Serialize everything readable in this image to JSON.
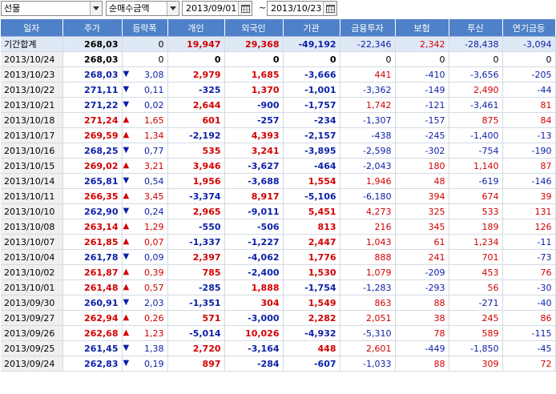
{
  "toolbar": {
    "market": "선물",
    "metric": "순매수금액",
    "date_from": "2013/09/01",
    "date_sep": "~",
    "date_to": "2013/10/23"
  },
  "columns": [
    "일자",
    "주가",
    "등락폭",
    "개인",
    "외국인",
    "기관",
    "금융투자",
    "보험",
    "투신",
    "연기금등"
  ],
  "summary": {
    "label": "기간합계",
    "price": "268,03",
    "change": "0",
    "individual": "19,947",
    "foreign": "29,368",
    "institution": "-49,192",
    "fin_invest": "-22,346",
    "insurance": "2,342",
    "trust": "-28,438",
    "pension": "-3,094"
  },
  "rows": [
    {
      "date": "2013/10/24",
      "price": "268,03",
      "dir": "",
      "change": "0",
      "individual": "0",
      "foreign": "0",
      "institution": "0",
      "fin_invest": "0",
      "insurance": "0",
      "trust": "0",
      "pension": "0"
    },
    {
      "date": "2013/10/23",
      "price": "268,03",
      "dir": "down",
      "change": "3,08",
      "individual": "2,979",
      "foreign": "1,685",
      "institution": "-3,666",
      "fin_invest": "441",
      "insurance": "-410",
      "trust": "-3,656",
      "pension": "-205"
    },
    {
      "date": "2013/10/22",
      "price": "271,11",
      "dir": "down",
      "change": "0,11",
      "individual": "-325",
      "foreign": "1,370",
      "institution": "-1,001",
      "fin_invest": "-3,362",
      "insurance": "-149",
      "trust": "2,490",
      "pension": "-44"
    },
    {
      "date": "2013/10/21",
      "price": "271,22",
      "dir": "down",
      "change": "0,02",
      "individual": "2,644",
      "foreign": "-900",
      "institution": "-1,757",
      "fin_invest": "1,742",
      "insurance": "-121",
      "trust": "-3,461",
      "pension": "81"
    },
    {
      "date": "2013/10/18",
      "price": "271,24",
      "dir": "up",
      "change": "1,65",
      "individual": "601",
      "foreign": "-257",
      "institution": "-234",
      "fin_invest": "-1,307",
      "insurance": "-157",
      "trust": "875",
      "pension": "84"
    },
    {
      "date": "2013/10/17",
      "price": "269,59",
      "dir": "up",
      "change": "1,34",
      "individual": "-2,192",
      "foreign": "4,393",
      "institution": "-2,157",
      "fin_invest": "-438",
      "insurance": "-245",
      "trust": "-1,400",
      "pension": "-13"
    },
    {
      "date": "2013/10/16",
      "price": "268,25",
      "dir": "down",
      "change": "0,77",
      "individual": "535",
      "foreign": "3,241",
      "institution": "-3,895",
      "fin_invest": "-2,598",
      "insurance": "-302",
      "trust": "-754",
      "pension": "-190"
    },
    {
      "date": "2013/10/15",
      "price": "269,02",
      "dir": "up",
      "change": "3,21",
      "individual": "3,946",
      "foreign": "-3,627",
      "institution": "-464",
      "fin_invest": "-2,043",
      "insurance": "180",
      "trust": "1,140",
      "pension": "87"
    },
    {
      "date": "2013/10/14",
      "price": "265,81",
      "dir": "down",
      "change": "0,54",
      "individual": "1,956",
      "foreign": "-3,688",
      "institution": "1,554",
      "fin_invest": "1,946",
      "insurance": "48",
      "trust": "-619",
      "pension": "-146"
    },
    {
      "date": "2013/10/11",
      "price": "266,35",
      "dir": "up",
      "change": "3,45",
      "individual": "-3,374",
      "foreign": "8,917",
      "institution": "-5,106",
      "fin_invest": "-6,180",
      "insurance": "394",
      "trust": "674",
      "pension": "39"
    },
    {
      "date": "2013/10/10",
      "price": "262,90",
      "dir": "down",
      "change": "0,24",
      "individual": "2,965",
      "foreign": "-9,011",
      "institution": "5,451",
      "fin_invest": "4,273",
      "insurance": "325",
      "trust": "533",
      "pension": "131"
    },
    {
      "date": "2013/10/08",
      "price": "263,14",
      "dir": "up",
      "change": "1,29",
      "individual": "-550",
      "foreign": "-506",
      "institution": "813",
      "fin_invest": "216",
      "insurance": "345",
      "trust": "189",
      "pension": "126"
    },
    {
      "date": "2013/10/07",
      "price": "261,85",
      "dir": "up",
      "change": "0,07",
      "individual": "-1,337",
      "foreign": "-1,227",
      "institution": "2,447",
      "fin_invest": "1,043",
      "insurance": "61",
      "trust": "1,234",
      "pension": "-11"
    },
    {
      "date": "2013/10/04",
      "price": "261,78",
      "dir": "down",
      "change": "0,09",
      "individual": "2,397",
      "foreign": "-4,062",
      "institution": "1,776",
      "fin_invest": "888",
      "insurance": "241",
      "trust": "701",
      "pension": "-73"
    },
    {
      "date": "2013/10/02",
      "price": "261,87",
      "dir": "up",
      "change": "0,39",
      "individual": "785",
      "foreign": "-2,400",
      "institution": "1,530",
      "fin_invest": "1,079",
      "insurance": "-209",
      "trust": "453",
      "pension": "76"
    },
    {
      "date": "2013/10/01",
      "price": "261,48",
      "dir": "up",
      "change": "0,57",
      "individual": "-285",
      "foreign": "1,888",
      "institution": "-1,754",
      "fin_invest": "-1,283",
      "insurance": "-293",
      "trust": "56",
      "pension": "-30"
    },
    {
      "date": "2013/09/30",
      "price": "260,91",
      "dir": "down",
      "change": "2,03",
      "individual": "-1,351",
      "foreign": "304",
      "institution": "1,549",
      "fin_invest": "863",
      "insurance": "88",
      "trust": "-271",
      "pension": "-40"
    },
    {
      "date": "2013/09/27",
      "price": "262,94",
      "dir": "up",
      "change": "0,26",
      "individual": "571",
      "foreign": "-3,000",
      "institution": "2,282",
      "fin_invest": "2,051",
      "insurance": "38",
      "trust": "245",
      "pension": "86"
    },
    {
      "date": "2013/09/26",
      "price": "262,68",
      "dir": "up",
      "change": "1,23",
      "individual": "-5,014",
      "foreign": "10,026",
      "institution": "-4,932",
      "fin_invest": "-5,310",
      "insurance": "78",
      "trust": "589",
      "pension": "-115"
    },
    {
      "date": "2013/09/25",
      "price": "261,45",
      "dir": "down",
      "change": "1,38",
      "individual": "2,720",
      "foreign": "-3,164",
      "institution": "448",
      "fin_invest": "2,601",
      "insurance": "-449",
      "trust": "-1,850",
      "pension": "-45"
    },
    {
      "date": "2013/09/24",
      "price": "262,83",
      "dir": "down",
      "change": "0,19",
      "individual": "897",
      "foreign": "-284",
      "institution": "-607",
      "fin_invest": "-1,033",
      "insurance": "88",
      "trust": "309",
      "pension": "72"
    }
  ],
  "colors": {
    "header_bg": "#4e81c7",
    "up": "#d20000",
    "down": "#0a1fa8",
    "summary_bg": "#dfe9f5",
    "date_bg": "#f0f0f0"
  }
}
